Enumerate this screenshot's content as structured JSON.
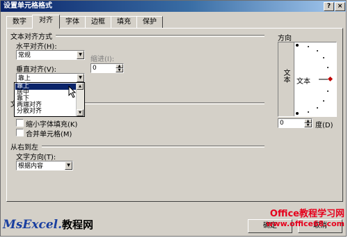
{
  "window": {
    "title": "设置单元格格式",
    "help_label": "?",
    "close_label": "×"
  },
  "tabs": [
    {
      "label": "数字"
    },
    {
      "label": "对齐"
    },
    {
      "label": "字体"
    },
    {
      "label": "边框"
    },
    {
      "label": "填充"
    },
    {
      "label": "保护"
    }
  ],
  "text_alignment": {
    "group_label": "文本对齐方式",
    "horizontal_label": "水平对齐(H):",
    "horizontal_value": "常规",
    "indent_label": "缩进(I):",
    "indent_value": "0",
    "vertical_label": "垂直对齐(V):",
    "vertical_value": "靠上",
    "vertical_options": [
      "靠上",
      "居中",
      "靠下",
      "两端对齐",
      "分散对齐"
    ]
  },
  "text_control": {
    "group_label": "文",
    "shrink_label": "缩小字体填充(K)",
    "merge_label": "合并单元格(M)"
  },
  "rtl": {
    "group_label": "从右到左",
    "direction_label": "文字方向(T):",
    "direction_value": "根据内容"
  },
  "orientation": {
    "group_label": "方向",
    "vertical_text": "文本",
    "dial_text": "文本",
    "degree_value": "0",
    "degree_label": "度(D)"
  },
  "buttons": {
    "ok": "确定",
    "cancel": "取消"
  },
  "watermarks": {
    "left_brand": "MsExcel.",
    "left_cn": "教程网",
    "right_brand": "Office教程学习网",
    "right_url": "www.office68.com"
  }
}
